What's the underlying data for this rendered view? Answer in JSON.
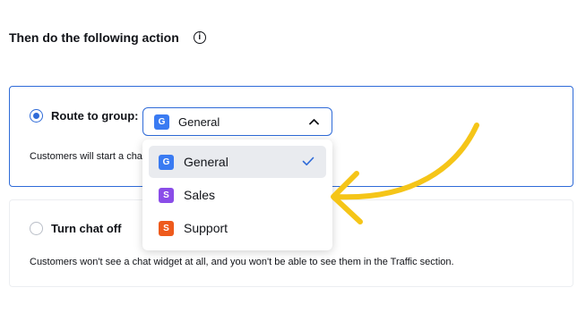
{
  "heading": {
    "title": "Then do the following action",
    "info_icon": "info-icon",
    "info_glyph": "i"
  },
  "route_option": {
    "label": "Route to group:",
    "selected": true,
    "description": "Customers will start a chat with the group you have picked",
    "select": {
      "value": "General",
      "badge": "G",
      "badge_color": "#3a7bf2",
      "expanded": true
    }
  },
  "dropdown": {
    "items": [
      {
        "label": "General",
        "badge": "G",
        "color": "#3a7bf2",
        "selected": true
      },
      {
        "label": "Sales",
        "badge": "S",
        "color": "#8a4de8",
        "selected": false
      },
      {
        "label": "Support",
        "badge": "S",
        "color": "#ee5a1c",
        "selected": false
      }
    ]
  },
  "off_option": {
    "label": "Turn chat off",
    "selected": false,
    "description": "Customers won't see a chat widget at all, and you won't be able to see them in the Traffic section."
  },
  "colors": {
    "accent": "#2f6bd8",
    "arrow": "#f5c518"
  }
}
